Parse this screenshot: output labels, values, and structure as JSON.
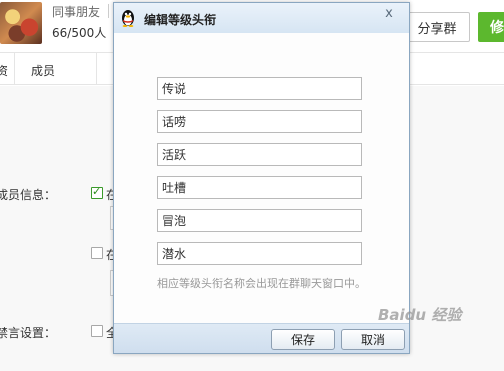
{
  "group": {
    "name": "同事朋友",
    "member_count": "66/500人",
    "share_label": "分享群",
    "edit_label": "修"
  },
  "tabs": {
    "left_partial": "资",
    "members": "成员"
  },
  "settings": {
    "member_info_label": "成员信息：",
    "member_info_check_text": "在",
    "second_check_text": "在",
    "mute_label": "禁言设置：",
    "mute_check_text": "全"
  },
  "dialog": {
    "title": "编辑等级头衔",
    "close_symbol": "x",
    "level_titles": [
      "传说",
      "话唠",
      "活跃",
      "吐槽",
      "冒泡",
      "潜水"
    ],
    "hint": "相应等级头衔名称会出现在群聊天窗口中。",
    "save_label": "保存",
    "cancel_label": "取消"
  },
  "watermark": "Baidu 经验"
}
